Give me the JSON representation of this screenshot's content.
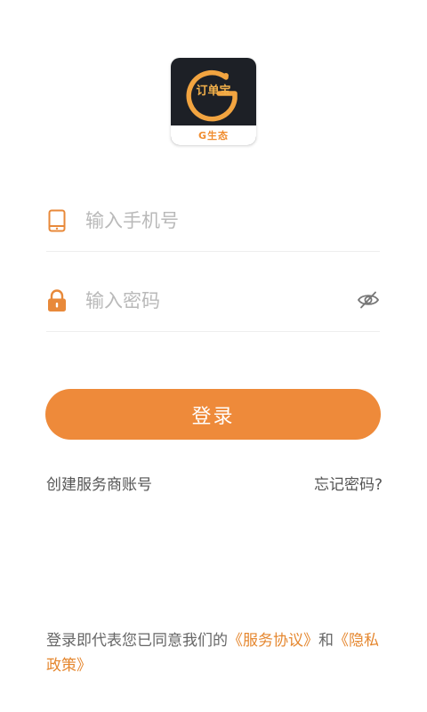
{
  "logo": {
    "brand_text": "订单宝",
    "strip_text": "G生态",
    "letter": "G"
  },
  "phone_field": {
    "placeholder": "输入手机号",
    "icon": "phone-icon"
  },
  "password_field": {
    "placeholder": "输入密码",
    "icon": "lock-icon",
    "toggle_icon": "eye-off-icon"
  },
  "login_button": {
    "label": "登录"
  },
  "links": {
    "create_account": "创建服务商账号",
    "forgot_password": "忘记密码?"
  },
  "agreement": {
    "prefix": "登录即代表您已同意我们的",
    "service_link": "《服务协议》",
    "conjunction": "和",
    "privacy_link": "《隐私政策》"
  },
  "colors": {
    "accent": "#ee8a3a",
    "logo_bg": "#1d2026",
    "link_orange": "#e5872f"
  }
}
